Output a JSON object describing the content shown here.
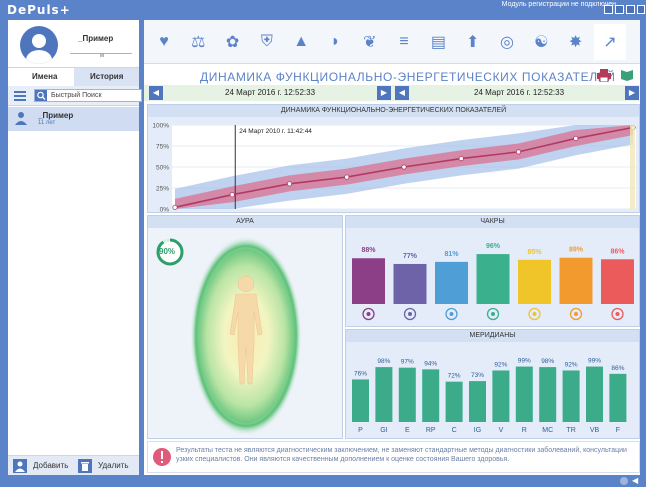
{
  "app": {
    "title": "DePuls+"
  },
  "profile": {
    "name": "_Пример",
    "subtitle": "м"
  },
  "sidebar": {
    "tab_names": "Имена",
    "tab_history": "История",
    "search_placeholder": "Быстрый Поиск",
    "items": [
      {
        "name": "_Пример",
        "age": "11 лет"
      }
    ],
    "add_label": "Добавить",
    "delete_label": "Удалить"
  },
  "toolbar": {
    "icons": [
      "heart-rate-icon",
      "balance-icon",
      "brain-icon",
      "shield-icon",
      "pyramid-icon",
      "liver-icon",
      "lungs-icon",
      "spine-icon",
      "ecg-icon",
      "energy-icon",
      "aura-circle-icon",
      "yin-yang-icon",
      "star-chakra-icon",
      "trend-chart-icon"
    ]
  },
  "main": {
    "title": "ДИНАМИКА ФУНКЦИОНАЛЬНО-ЭНЕРГЕТИЧЕСКИХ ПОКАЗАТЕЛЕЙ",
    "date_left": "24 Март 2016 г. 12:52:33",
    "date_right": "24 Март 2016 г. 12:52:33"
  },
  "chart_data": [
    {
      "type": "line",
      "title": "ДИНАМИКА ФУНКЦИОНАЛЬНО-ЭНЕРГЕТИЧЕСКИХ ПОКАЗАТЕЛЕЙ",
      "y_ticks": [
        "100%",
        "75%",
        "50%",
        "25%",
        "0%"
      ],
      "ylim": [
        0,
        100
      ],
      "marker_label": "24 Март 2010 г. 11:42:44",
      "series": [
        {
          "values": [
            2,
            17,
            30,
            38,
            50,
            60,
            68,
            84,
            97
          ]
        }
      ],
      "grid": true
    },
    {
      "type": "bar",
      "title": "ЧАКРЫ",
      "values": [
        88,
        77,
        81,
        96,
        85,
        89,
        86
      ],
      "labels": [
        "88%",
        "77%",
        "81%",
        "96%",
        "85%",
        "89%",
        "86%"
      ],
      "colors": [
        "#8c3f86",
        "#6e63a8",
        "#4f9fd6",
        "#3bb08c",
        "#efc52a",
        "#f39a2f",
        "#ec5b5b"
      ]
    },
    {
      "type": "bar",
      "title": "МЕРИДИАНЫ",
      "categories": [
        "P",
        "GI",
        "E",
        "RP",
        "C",
        "IG",
        "V",
        "R",
        "MC",
        "TR",
        "VB",
        "F"
      ],
      "values": [
        76,
        98,
        97,
        94,
        72,
        73,
        92,
        99,
        98,
        92,
        99,
        86
      ],
      "labels": [
        "76%",
        "98%",
        "97%",
        "94%",
        "72%",
        "73%",
        "92%",
        "99%",
        "98%",
        "92%",
        "99%",
        "86%"
      ],
      "color": "#3bab8a"
    }
  ],
  "aura": {
    "title": "АУРА",
    "percent": "90%",
    "fraction": 0.9
  },
  "disclaimer": "Результаты теста не являются диагностическим заключением, не заменяют стандартные методы диагностики заболеваний, консультации узких специалистов. Они являются качественным дополнением к оценке состояния Вашего здоровья.",
  "status": {
    "text": "Модуль регистрации не подключен"
  }
}
